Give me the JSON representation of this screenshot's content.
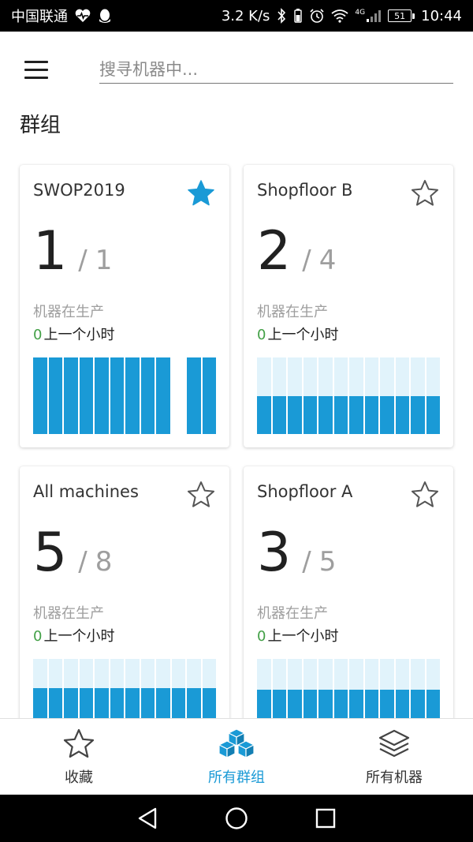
{
  "status_bar": {
    "carrier": "中国联通",
    "speed": "3.2 K/s",
    "network": "4G",
    "battery": "51",
    "time": "10:44"
  },
  "search": {
    "placeholder": "搜寻机器中..."
  },
  "section_title": "群组",
  "card_labels": {
    "producing": "机器在生产",
    "last_hour": "上一个小时"
  },
  "cards": [
    {
      "name": "SWOP2019",
      "favorite": true,
      "active": "1",
      "total": "1",
      "last_hour": "0",
      "bars": [
        1,
        1,
        1,
        1,
        1,
        1,
        1,
        1,
        1,
        0,
        1,
        1
      ]
    },
    {
      "name": "Shopfloor B",
      "favorite": false,
      "active": "2",
      "total": "4",
      "last_hour": "0",
      "bars": [
        0.5,
        0.5,
        0.5,
        0.5,
        0.5,
        0.5,
        0.5,
        0.5,
        0.5,
        0.5,
        0.5,
        0.5
      ]
    },
    {
      "name": "All machines",
      "favorite": false,
      "active": "5",
      "total": "8",
      "last_hour": "0",
      "bars": [
        0.62,
        0.62,
        0.62,
        0.62,
        0.62,
        0.62,
        0.62,
        0.62,
        0.62,
        0.62,
        0.62,
        0.62
      ]
    },
    {
      "name": "Shopfloor A",
      "favorite": false,
      "active": "3",
      "total": "5",
      "last_hour": "0",
      "bars": [
        0.6,
        0.6,
        0.6,
        0.6,
        0.6,
        0.6,
        0.6,
        0.6,
        0.6,
        0.6,
        0.6,
        0.6
      ]
    }
  ],
  "bottom_nav": {
    "favorites": "收藏",
    "all_groups": "所有群组",
    "all_machines": "所有机器",
    "active": "all_groups"
  },
  "colors": {
    "accent": "#1a9ad6",
    "bar_background": "#e1f3fb",
    "zero_green": "#43a047"
  },
  "icons": {
    "status": [
      "heart-pulse-icon",
      "qq-penguin-icon",
      "bluetooth-icon",
      "alarm-icon",
      "wifi-icon",
      "signal-icon",
      "battery-icon"
    ],
    "nav": [
      "star-outline-icon",
      "cubes-icon",
      "layers-icon"
    ],
    "system": [
      "back-triangle-icon",
      "home-circle-icon",
      "recents-square-icon"
    ]
  }
}
